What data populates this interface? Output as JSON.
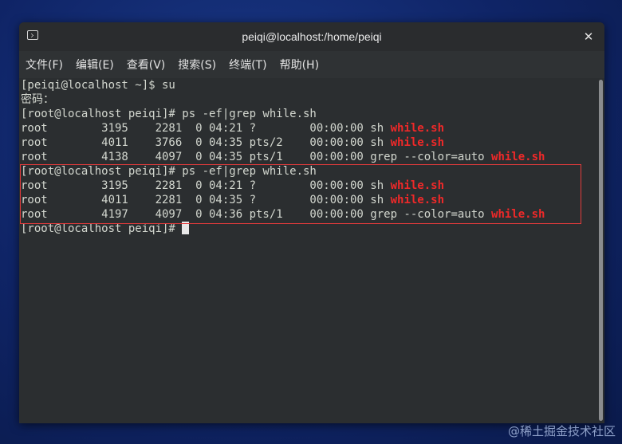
{
  "window": {
    "title": "peiqi@localhost:/home/peiqi",
    "close_glyph": "✕"
  },
  "menu": [
    "文件(F)",
    "编辑(E)",
    "查看(V)",
    "搜索(S)",
    "终端(T)",
    "帮助(H)"
  ],
  "terminal": {
    "lines": [
      {
        "text": "[peiqi@localhost ~]$ su",
        "hl": ""
      },
      {
        "text": "密码：",
        "hl": ""
      },
      {
        "text": "[root@localhost peiqi]# ps -ef|grep while.sh",
        "hl": ""
      },
      {
        "text": "root        3195    2281  0 04:21 ?        00:00:00 sh ",
        "hl": "while.sh"
      },
      {
        "text": "root        4011    3766  0 04:35 pts/2    00:00:00 sh ",
        "hl": "while.sh"
      },
      {
        "text": "root        4138    4097  0 04:35 pts/1    00:00:00 grep --color=auto ",
        "hl": "while.sh"
      },
      {
        "text": "[root@localhost peiqi]# ps -ef|grep while.sh",
        "hl": ""
      },
      {
        "text": "root        3195    2281  0 04:21 ?        00:00:00 sh ",
        "hl": "while.sh"
      },
      {
        "text": "root        4011    2281  0 04:35 ?        00:00:00 sh ",
        "hl": "while.sh"
      },
      {
        "text": "root        4197    4097  0 04:36 pts/1    00:00:00 grep --color=auto ",
        "hl": "while.sh"
      },
      {
        "text": "[root@localhost peiqi]# ",
        "hl": ""
      }
    ],
    "highlight_color": "#ef2929",
    "box_color": "#e23b3b"
  },
  "watermark": "@稀土掘金技术社区",
  "icons": {
    "app": "terminal-icon",
    "close": "close-icon"
  }
}
